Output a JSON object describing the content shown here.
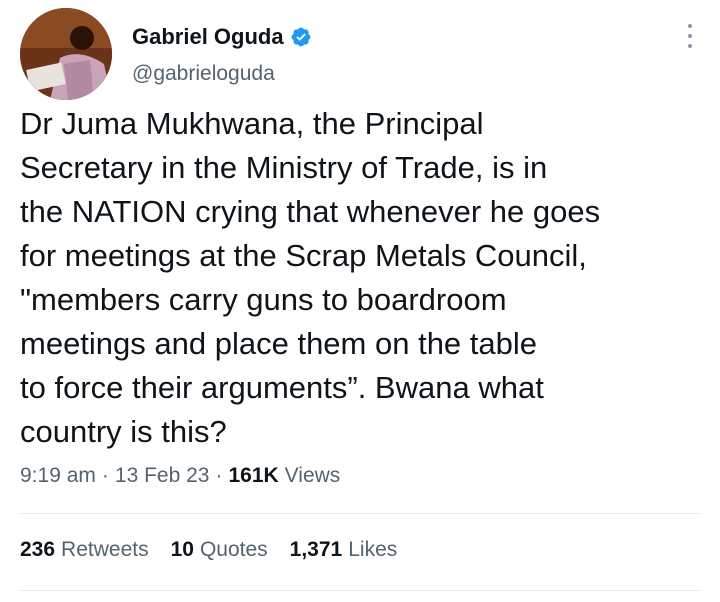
{
  "author": {
    "name": "Gabriel Oguda",
    "handle": "@gabrieloguda",
    "verified": true,
    "verified_color": "#1d9bf0"
  },
  "tweet": {
    "text": "Dr Juma Mukhwana, the Principal\nSecretary in the Ministry of Trade, is in\nthe NATION crying that whenever he goes\nfor meetings at the Scrap Metals Council,\n\"members carry guns to boardroom\nmeetings and place them on the table\nto force their arguments”. Bwana what\ncountry is this?",
    "time": "9:19 am",
    "separator": "·",
    "date": "13 Feb 23",
    "views_count": "161K",
    "views_label": "Views"
  },
  "stats": {
    "retweets_count": "236",
    "retweets_label": "Retweets",
    "quotes_count": "10",
    "quotes_label": "Quotes",
    "likes_count": "1,371",
    "likes_label": "Likes"
  },
  "icons": {
    "verified": "verified-badge-icon",
    "more": "more-options-icon"
  }
}
